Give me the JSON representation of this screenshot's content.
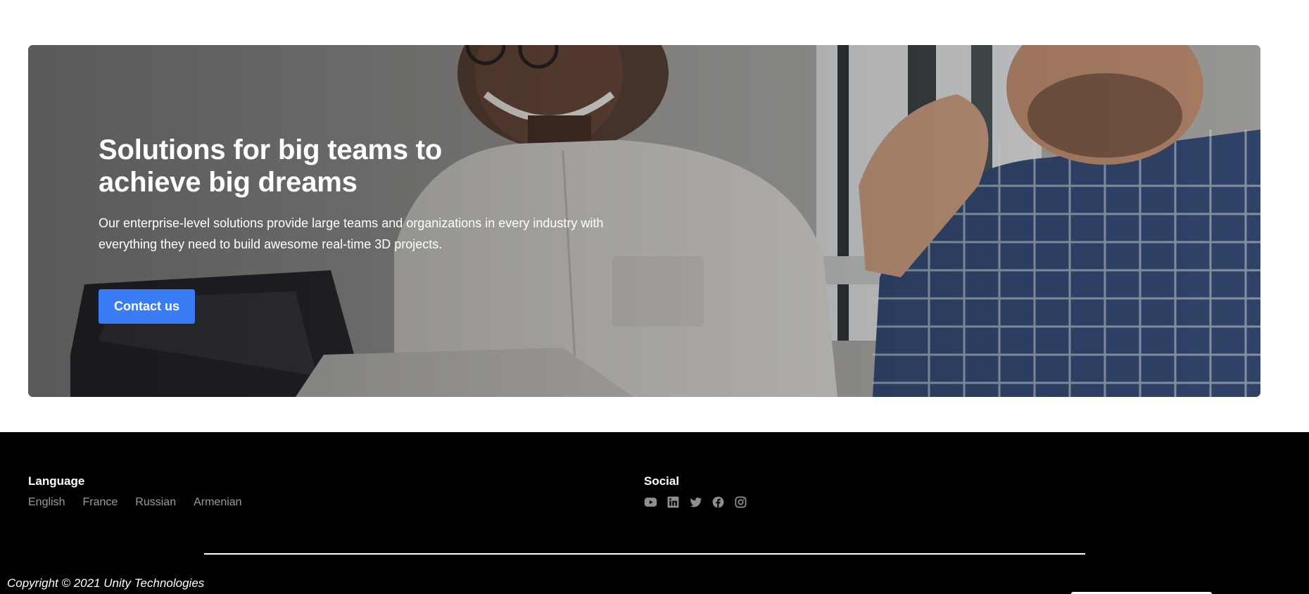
{
  "hero": {
    "title": "Solutions for big teams to achieve big dreams",
    "description": "Our enterprise-level solutions provide large teams and organizations in every industry with everything they need to build awesome real-time 3D projects.",
    "button_label": "Contact us",
    "button_color": "#3a7cf6"
  },
  "footer": {
    "language": {
      "heading": "Language",
      "items": [
        {
          "label": "English"
        },
        {
          "label": "France"
        },
        {
          "label": "Russian"
        },
        {
          "label": "Armenian"
        }
      ]
    },
    "social": {
      "heading": "Social",
      "icons": [
        "youtube-icon",
        "linkedin-icon",
        "twitter-icon",
        "facebook-icon",
        "instagram-icon"
      ]
    },
    "copyright": "Copyright © 2021 Unity Technologies"
  },
  "colors": {
    "footer_bg": "#000000",
    "link_gray": "#9a9a9a"
  }
}
